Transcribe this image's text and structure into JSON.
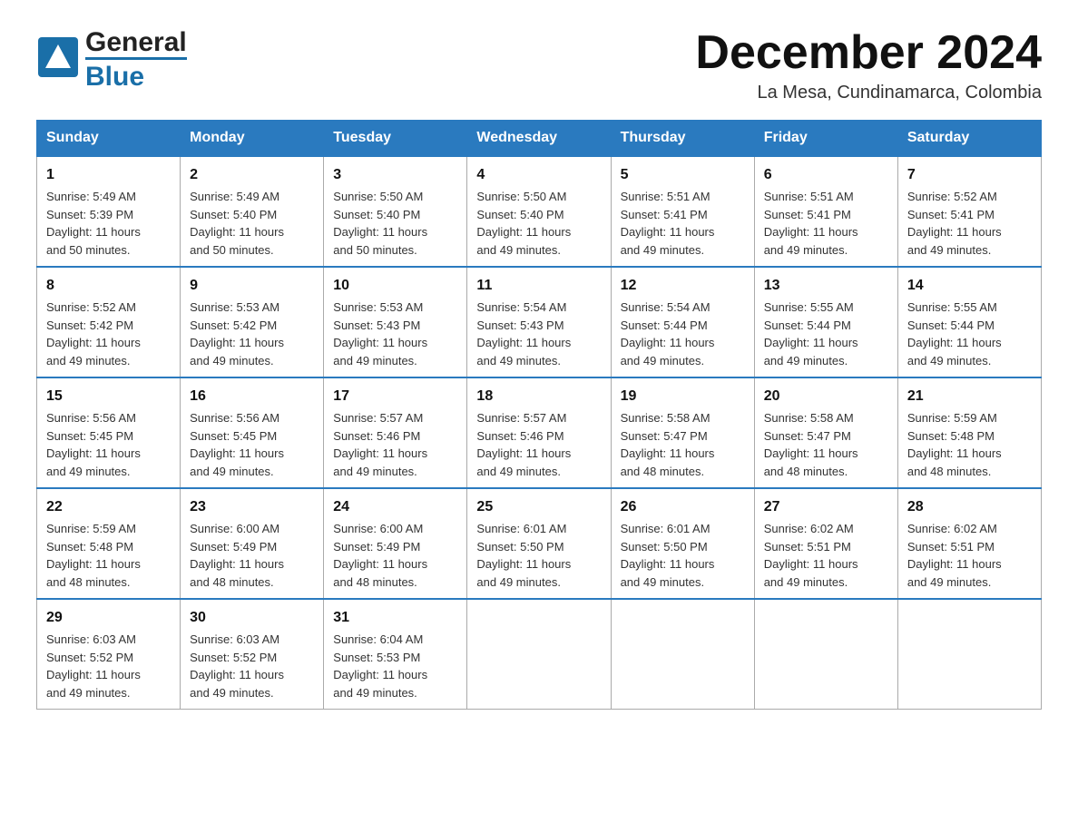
{
  "header": {
    "logo_general": "General",
    "logo_blue": "Blue",
    "month_title": "December 2024",
    "location": "La Mesa, Cundinamarca, Colombia"
  },
  "weekdays": [
    "Sunday",
    "Monday",
    "Tuesday",
    "Wednesday",
    "Thursday",
    "Friday",
    "Saturday"
  ],
  "weeks": [
    [
      {
        "day": "1",
        "info": "Sunrise: 5:49 AM\nSunset: 5:39 PM\nDaylight: 11 hours\nand 50 minutes."
      },
      {
        "day": "2",
        "info": "Sunrise: 5:49 AM\nSunset: 5:40 PM\nDaylight: 11 hours\nand 50 minutes."
      },
      {
        "day": "3",
        "info": "Sunrise: 5:50 AM\nSunset: 5:40 PM\nDaylight: 11 hours\nand 50 minutes."
      },
      {
        "day": "4",
        "info": "Sunrise: 5:50 AM\nSunset: 5:40 PM\nDaylight: 11 hours\nand 49 minutes."
      },
      {
        "day": "5",
        "info": "Sunrise: 5:51 AM\nSunset: 5:41 PM\nDaylight: 11 hours\nand 49 minutes."
      },
      {
        "day": "6",
        "info": "Sunrise: 5:51 AM\nSunset: 5:41 PM\nDaylight: 11 hours\nand 49 minutes."
      },
      {
        "day": "7",
        "info": "Sunrise: 5:52 AM\nSunset: 5:41 PM\nDaylight: 11 hours\nand 49 minutes."
      }
    ],
    [
      {
        "day": "8",
        "info": "Sunrise: 5:52 AM\nSunset: 5:42 PM\nDaylight: 11 hours\nand 49 minutes."
      },
      {
        "day": "9",
        "info": "Sunrise: 5:53 AM\nSunset: 5:42 PM\nDaylight: 11 hours\nand 49 minutes."
      },
      {
        "day": "10",
        "info": "Sunrise: 5:53 AM\nSunset: 5:43 PM\nDaylight: 11 hours\nand 49 minutes."
      },
      {
        "day": "11",
        "info": "Sunrise: 5:54 AM\nSunset: 5:43 PM\nDaylight: 11 hours\nand 49 minutes."
      },
      {
        "day": "12",
        "info": "Sunrise: 5:54 AM\nSunset: 5:44 PM\nDaylight: 11 hours\nand 49 minutes."
      },
      {
        "day": "13",
        "info": "Sunrise: 5:55 AM\nSunset: 5:44 PM\nDaylight: 11 hours\nand 49 minutes."
      },
      {
        "day": "14",
        "info": "Sunrise: 5:55 AM\nSunset: 5:44 PM\nDaylight: 11 hours\nand 49 minutes."
      }
    ],
    [
      {
        "day": "15",
        "info": "Sunrise: 5:56 AM\nSunset: 5:45 PM\nDaylight: 11 hours\nand 49 minutes."
      },
      {
        "day": "16",
        "info": "Sunrise: 5:56 AM\nSunset: 5:45 PM\nDaylight: 11 hours\nand 49 minutes."
      },
      {
        "day": "17",
        "info": "Sunrise: 5:57 AM\nSunset: 5:46 PM\nDaylight: 11 hours\nand 49 minutes."
      },
      {
        "day": "18",
        "info": "Sunrise: 5:57 AM\nSunset: 5:46 PM\nDaylight: 11 hours\nand 49 minutes."
      },
      {
        "day": "19",
        "info": "Sunrise: 5:58 AM\nSunset: 5:47 PM\nDaylight: 11 hours\nand 48 minutes."
      },
      {
        "day": "20",
        "info": "Sunrise: 5:58 AM\nSunset: 5:47 PM\nDaylight: 11 hours\nand 48 minutes."
      },
      {
        "day": "21",
        "info": "Sunrise: 5:59 AM\nSunset: 5:48 PM\nDaylight: 11 hours\nand 48 minutes."
      }
    ],
    [
      {
        "day": "22",
        "info": "Sunrise: 5:59 AM\nSunset: 5:48 PM\nDaylight: 11 hours\nand 48 minutes."
      },
      {
        "day": "23",
        "info": "Sunrise: 6:00 AM\nSunset: 5:49 PM\nDaylight: 11 hours\nand 48 minutes."
      },
      {
        "day": "24",
        "info": "Sunrise: 6:00 AM\nSunset: 5:49 PM\nDaylight: 11 hours\nand 48 minutes."
      },
      {
        "day": "25",
        "info": "Sunrise: 6:01 AM\nSunset: 5:50 PM\nDaylight: 11 hours\nand 49 minutes."
      },
      {
        "day": "26",
        "info": "Sunrise: 6:01 AM\nSunset: 5:50 PM\nDaylight: 11 hours\nand 49 minutes."
      },
      {
        "day": "27",
        "info": "Sunrise: 6:02 AM\nSunset: 5:51 PM\nDaylight: 11 hours\nand 49 minutes."
      },
      {
        "day": "28",
        "info": "Sunrise: 6:02 AM\nSunset: 5:51 PM\nDaylight: 11 hours\nand 49 minutes."
      }
    ],
    [
      {
        "day": "29",
        "info": "Sunrise: 6:03 AM\nSunset: 5:52 PM\nDaylight: 11 hours\nand 49 minutes."
      },
      {
        "day": "30",
        "info": "Sunrise: 6:03 AM\nSunset: 5:52 PM\nDaylight: 11 hours\nand 49 minutes."
      },
      {
        "day": "31",
        "info": "Sunrise: 6:04 AM\nSunset: 5:53 PM\nDaylight: 11 hours\nand 49 minutes."
      },
      {
        "day": "",
        "info": ""
      },
      {
        "day": "",
        "info": ""
      },
      {
        "day": "",
        "info": ""
      },
      {
        "day": "",
        "info": ""
      }
    ]
  ]
}
